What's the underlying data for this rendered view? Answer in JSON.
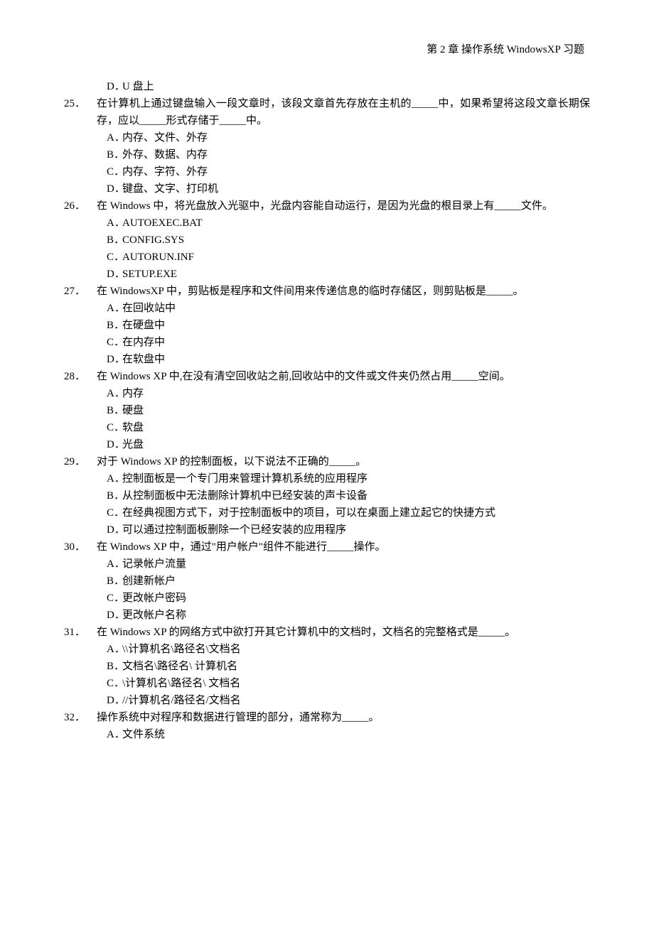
{
  "header": "第 2 章  操作系统 WindowsXP 习题",
  "prev_option": {
    "label": "D．",
    "text": "U 盘上"
  },
  "questions": [
    {
      "num": "25．",
      "text": " 在计算机上通过键盘输入一段文章时，该段文章首先存放在主机的_____中，如果希望将这段文章长期保存，应以_____形式存储于_____中。",
      "opts": [
        {
          "label": "A．",
          "text": "内存、文件、外存"
        },
        {
          "label": "B．",
          "text": "外存、数据、内存"
        },
        {
          "label": "C．",
          "text": "内存、字符、外存"
        },
        {
          "label": "D．",
          "text": "键盘、文字、打印机"
        }
      ]
    },
    {
      "num": "26．",
      "text": "在 Windows 中，将光盘放入光驱中，光盘内容能自动运行，是因为光盘的根目录上有_____文件。",
      "opts": [
        {
          "label": "A．",
          "text": "AUTOEXEC.BAT"
        },
        {
          "label": "B．",
          "text": "CONFIG.SYS"
        },
        {
          "label": "C．",
          "text": "AUTORUN.INF"
        },
        {
          "label": "D．",
          "text": "SETUP.EXE"
        }
      ]
    },
    {
      "num": "27．",
      "text": "在 WindowsXP 中，剪贴板是程序和文件间用来传递信息的临时存储区，则剪贴板是_____。",
      "opts": [
        {
          "label": "A．",
          "text": "在回收站中"
        },
        {
          "label": "B．",
          "text": "在硬盘中"
        },
        {
          "label": "C．",
          "text": "在内存中"
        },
        {
          "label": "D．",
          "text": "在软盘中"
        }
      ]
    },
    {
      "num": "28．",
      "text": "在 Windows XP 中,在没有清空回收站之前,回收站中的文件或文件夹仍然占用_____空间。",
      "opts": [
        {
          "label": "A．",
          "text": "内存"
        },
        {
          "label": "B．",
          "text": "硬盘"
        },
        {
          "label": "C．",
          "text": "软盘"
        },
        {
          "label": "D．",
          "text": "光盘"
        }
      ]
    },
    {
      "num": "29．",
      "text": "对于 Windows XP 的控制面板，以下说法不正确的_____。",
      "opts": [
        {
          "label": "A．",
          "text": "控制面板是一个专门用来管理计算机系统的应用程序"
        },
        {
          "label": "B．",
          "text": "从控制面板中无法删除计算机中已经安装的声卡设备"
        },
        {
          "label": "C．",
          "text": "在经典视图方式下，对于控制面板中的项目，可以在桌面上建立起它的快捷方式"
        },
        {
          "label": "D．",
          "text": "可以通过控制面板删除一个已经安装的应用程序"
        }
      ]
    },
    {
      "num": "30．",
      "text": "在 Windows XP 中，通过\"用户帐户\"组件不能进行_____操作。",
      "opts": [
        {
          "label": "A．",
          "text": "记录帐户流量"
        },
        {
          "label": "B．",
          "text": "创建新帐户"
        },
        {
          "label": "C．",
          "text": "更改帐户密码"
        },
        {
          "label": "D．",
          "text": "更改帐户名称"
        }
      ]
    },
    {
      "num": "31．",
      "text": "在 Windows XP 的网络方式中欲打开其它计算机中的文档时，文档名的完整格式是_____。",
      "opts": [
        {
          "label": "A．",
          "text": "\\\\计算机名\\路径名\\文档名"
        },
        {
          "label": "B．",
          "text": "文档名\\路径名\\ 计算机名"
        },
        {
          "label": "C．",
          "text": "\\计算机名\\路径名\\ 文档名"
        },
        {
          "label": "D．",
          "text": "//计算机名/路径名/文档名"
        }
      ]
    },
    {
      "num": "32．",
      "text": "操作系统中对程序和数据进行管理的部分，通常称为_____。",
      "opts": [
        {
          "label": "A．",
          "text": "文件系统"
        }
      ]
    }
  ]
}
